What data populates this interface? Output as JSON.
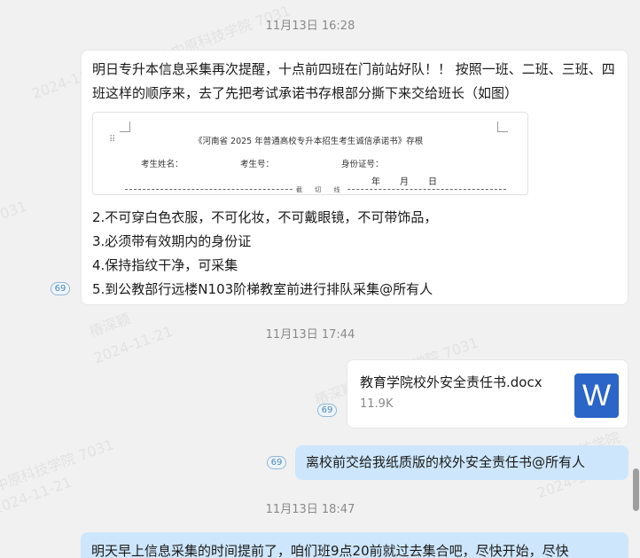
{
  "watermark": {
    "name": "樁深颖",
    "school": "中原科技学院",
    "id": "7031",
    "date": "2024-11-21"
  },
  "messages": [
    {
      "timestamp": "11月13日 16:28",
      "read_count": "69",
      "text_first": "明日专升本信息采集再次提醒，十点前四班在门前站好队！！ 按照一班、二班、三班、四班这样的顺序来，去了先把考试承诺书存根部分撕下来交给班长（如图）",
      "image": {
        "title": "《河南省 2025 年普通高校专升本招生考生诚信承诺书》存根",
        "field_name": "考生姓名：",
        "field_number": "考生号：",
        "field_id": "身份证号：",
        "date_year": "年",
        "date_month": "月",
        "date_day": "日",
        "cut_label": "截 切 线"
      },
      "lines": [
        "2.不可穿白色衣服，不可化妆，不可戴眼镜，不可带饰品，",
        "3.必须带有效期内的身份证",
        "4.保持指纹干净，可采集",
        "5.到公教部行远楼N103阶梯教室前进行排队采集@所有人"
      ]
    },
    {
      "timestamp": "11月13日 17:44",
      "read_count": "69",
      "file": {
        "name": "教育学院校外安全责任书.docx",
        "size": "11.9K",
        "icon": "word-doc-icon",
        "icon_letter": "W"
      }
    },
    {
      "read_count": "69",
      "text": "离校前交给我纸质版的校外安全责任书@所有人"
    },
    {
      "timestamp": "11月13日 18:47",
      "text": "明天早上信息采集的时间提前了，咱们班9点20前就过去集合吧，尽快开始，尽快"
    }
  ],
  "colors": {
    "background": "#f1f1f1",
    "incoming_bubble": "#ffffff",
    "outgoing_bubble": "#cde6fb",
    "word_blue": "#2b65c7"
  }
}
